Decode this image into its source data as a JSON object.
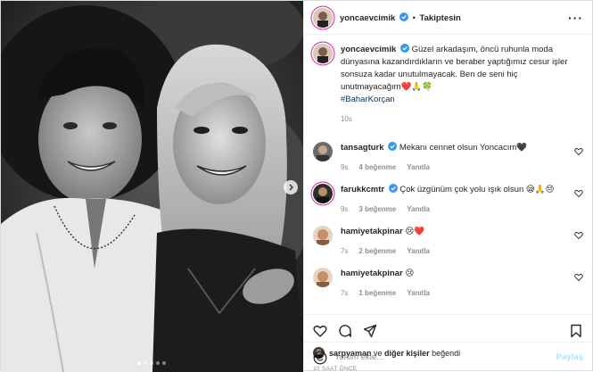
{
  "author": {
    "username": "yoncaevcimik",
    "follow_status": "Takiptesin",
    "separator": "•"
  },
  "caption": {
    "username": "yoncaevcimik",
    "text": "Güzel arkadaşım, öncü ruhunla moda dünyasına kazandırdıkların ve beraber yaptığımız cesur işler sonsuza kadar unutulmayacak. Ben de seni hiç unutmayacağım❤️🙏🍀",
    "hashtag": "#BaharKorçan",
    "time": "10s"
  },
  "comments": [
    {
      "username": "tansagturk",
      "text": "Mekanı cennet olsun Yoncacım🖤",
      "time": "9s",
      "likes": "4 beğenme",
      "reply": "Yanıtla"
    },
    {
      "username": "farukkcmtr",
      "text": "Çok üzgünüm çok yolu ışık olsun 😪🙏😔",
      "time": "9s",
      "likes": "3 beğenme",
      "reply": "Yanıtla"
    },
    {
      "username": "hamiyetakpinar",
      "text": "😢❤️",
      "time": "7s",
      "likes": "2 beğenme",
      "reply": "Yanıtla"
    },
    {
      "username": "hamiyetakpinar",
      "text": "😢",
      "time": "7s",
      "likes": "1 beğenme",
      "reply": "Yanıtla"
    }
  ],
  "likes": {
    "user": "sarpyaman",
    "middle": "ve",
    "others": "diğer kişiler",
    "suffix": "beğendi"
  },
  "timestamp": "10 SAAT ÖNCE",
  "add_comment": {
    "placeholder": "Yorum ekle...",
    "post_label": "Paylaş"
  },
  "carousel": {
    "slides": 5,
    "active": 1
  },
  "icons": [
    "heart-icon",
    "comment-icon",
    "share-icon",
    "bookmark-icon",
    "emoji-icon",
    "more-icon",
    "chevron-right-icon",
    "verified-icon"
  ],
  "colors": {
    "verified": "#3897f0",
    "hashtag": "#00376b",
    "post_button": "#b2dffc",
    "muted": "#8e8e8e"
  }
}
